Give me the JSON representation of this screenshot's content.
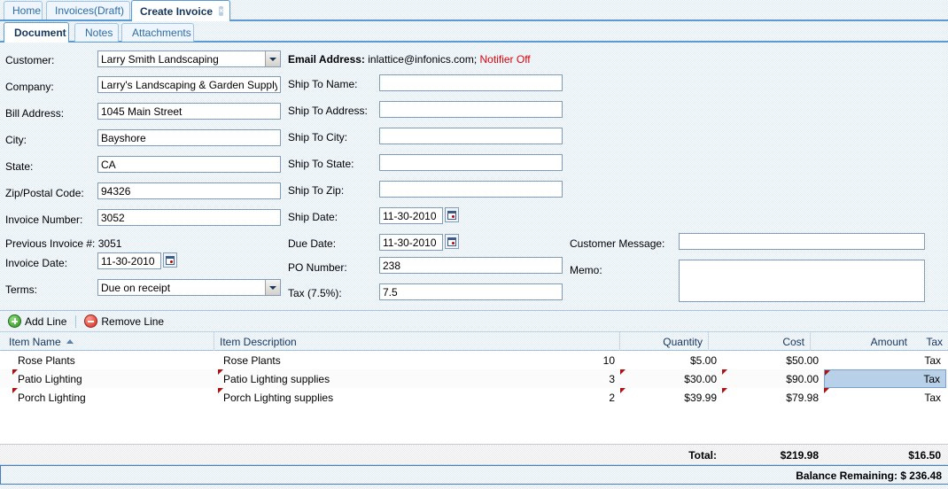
{
  "window": {
    "outer_tabs": [
      {
        "label": "Home",
        "active": false,
        "closable": false
      },
      {
        "label": "Invoices(Draft)",
        "active": false,
        "closable": false
      },
      {
        "label": "Create Invoice",
        "active": true,
        "closable": true,
        "close_glyph": "×"
      }
    ],
    "sub_tabs": [
      {
        "label": "Document",
        "active": true
      },
      {
        "label": "Notes",
        "active": false
      },
      {
        "label": "Attachments",
        "active": false
      }
    ]
  },
  "form": {
    "left": {
      "customer_label": "Customer:",
      "customer_value": "Larry Smith Landscaping",
      "company_label": "Company:",
      "company_value": "Larry's Landscaping & Garden Supply",
      "bill_address_label": "Bill Address:",
      "bill_address_value": "1045 Main Street",
      "city_label": "City:",
      "city_value": "Bayshore",
      "state_label": "State:",
      "state_value": "CA",
      "zip_label": "Zip/Postal Code:",
      "zip_value": "94326",
      "invoice_number_label": "Invoice Number:",
      "invoice_number_value": "3052",
      "previous_invoice": "Previous Invoice #: 3051",
      "invoice_date_label": "Invoice Date:",
      "invoice_date_value": "11-30-2010",
      "terms_label": "Terms:",
      "terms_value": "Due on receipt"
    },
    "middle": {
      "email_prefix": "Email Address:",
      "email_value": "inlattice@infonics.com;",
      "notifier_status": "Notifier Off",
      "ship_to_name_label": "Ship To Name:",
      "ship_to_name_value": "",
      "ship_to_address_label": "Ship To Address:",
      "ship_to_address_value": "",
      "ship_to_city_label": "Ship To City:",
      "ship_to_city_value": "",
      "ship_to_state_label": "Ship To State:",
      "ship_to_state_value": "",
      "ship_to_zip_label": "Ship To Zip:",
      "ship_to_zip_value": "",
      "ship_date_label": "Ship Date:",
      "ship_date_value": "11-30-2010",
      "due_date_label": "Due Date:",
      "due_date_value": "11-30-2010",
      "po_number_label": "PO Number:",
      "po_number_value": "238",
      "tax_label": "Tax (7.5%):",
      "tax_value": "7.5"
    },
    "right": {
      "customer_message_label": "Customer Message:",
      "customer_message_value": "",
      "memo_label": "Memo:",
      "memo_value": ""
    }
  },
  "grid_toolbar": {
    "add_line_label": "Add Line",
    "remove_line_label": "Remove Line"
  },
  "grid": {
    "columns": [
      {
        "label": "Item Name",
        "align": "left",
        "sorted": "asc"
      },
      {
        "label": "Item Description",
        "align": "left",
        "sorted": null
      },
      {
        "label": "Quantity",
        "align": "right",
        "sorted": null
      },
      {
        "label": "Cost",
        "align": "right",
        "sorted": null
      },
      {
        "label": "Amount",
        "align": "right",
        "sorted": null
      },
      {
        "label": "Tax",
        "align": "right",
        "sorted": null
      }
    ],
    "rows": [
      {
        "item_name": "Rose Plants",
        "item_description": "Rose Plants",
        "quantity": "10",
        "cost": "$5.00",
        "amount": "$50.00",
        "tax": "Tax"
      },
      {
        "item_name": "Patio Lighting",
        "item_description": "Patio Lighting supplies",
        "quantity": "3",
        "cost": "$30.00",
        "amount": "$90.00",
        "tax": "Tax"
      },
      {
        "item_name": "Porch Lighting",
        "item_description": "Porch Lighting supplies",
        "quantity": "2",
        "cost": "$39.99",
        "amount": "$79.98",
        "tax": "Tax"
      }
    ]
  },
  "totals": {
    "total_label": "Total:",
    "total_amount": "$219.98",
    "total_tax": "$16.50",
    "balance_remaining": "Balance Remaining: $ 236.48"
  },
  "colors": {
    "accent_blue": "#5b9bd5",
    "tab_text": "#15365c",
    "alert_red": "#e00000",
    "selection_blue": "#b8d0e8",
    "dirty_marker_red": "#b01010"
  }
}
